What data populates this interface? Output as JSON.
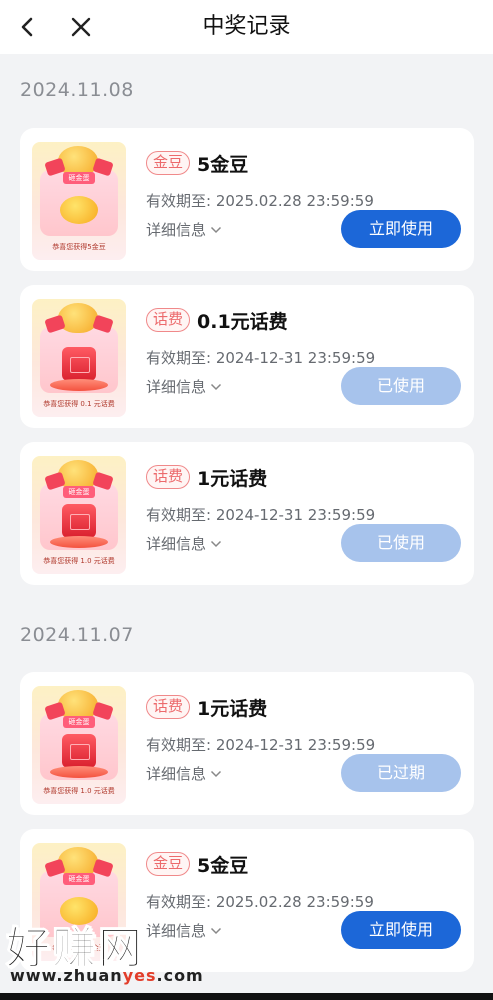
{
  "header": {
    "title": "中奖记录",
    "back_icon": "chevron-left-icon",
    "close_icon": "close-icon"
  },
  "groups": [
    {
      "date": "2024.11.08",
      "items": [
        {
          "badge": "金豆",
          "title": "5金豆",
          "expiry_label": "有效期至:",
          "expiry_value": "2025.02.28 23:59:59",
          "details": "详细信息",
          "action": "立即使用",
          "state": "active",
          "thumb_caption": "恭喜您获得5金豆",
          "thumb_tag": "砸金蛋"
        },
        {
          "badge": "话费",
          "title": "0.1元话费",
          "expiry_label": "有效期至:",
          "expiry_value": "2024-12-31 23:59:59",
          "details": "详细信息",
          "action": "已使用",
          "state": "used",
          "thumb_caption": "恭喜您获得 0.1 元话费",
          "thumb_tag": "砸金蛋"
        },
        {
          "badge": "话费",
          "title": "1元话费",
          "expiry_label": "有效期至:",
          "expiry_value": "2024-12-31 23:59:59",
          "details": "详细信息",
          "action": "已使用",
          "state": "used",
          "thumb_caption": "恭喜您获得 1.0 元话费",
          "thumb_tag": "砸金蛋"
        }
      ]
    },
    {
      "date": "2024.11.07",
      "items": [
        {
          "badge": "话费",
          "title": "1元话费",
          "expiry_label": "有效期至:",
          "expiry_value": "2024-12-31 23:59:59",
          "details": "详细信息",
          "action": "已过期",
          "state": "expired",
          "thumb_caption": "恭喜您获得 1.0 元话费",
          "thumb_tag": "砸金蛋"
        },
        {
          "badge": "金豆",
          "title": "5金豆",
          "expiry_label": "有效期至:",
          "expiry_value": "2025.02.28 23:59:59",
          "details": "详细信息",
          "action": "立即使用",
          "state": "active",
          "thumb_caption": "恭喜您获得5金豆",
          "thumb_tag": "砸金蛋"
        }
      ]
    }
  ],
  "watermark": {
    "main": "好赚网",
    "url_prefix": "www.zhuan",
    "url_accent": "yes",
    "url_suffix": ".com"
  },
  "colors": {
    "primary_button": "#1c67d8",
    "disabled_button": "#a7c3ec",
    "badge_border": "#f0898a",
    "badge_text": "#ec6a6c",
    "background": "#f2f3f5"
  }
}
